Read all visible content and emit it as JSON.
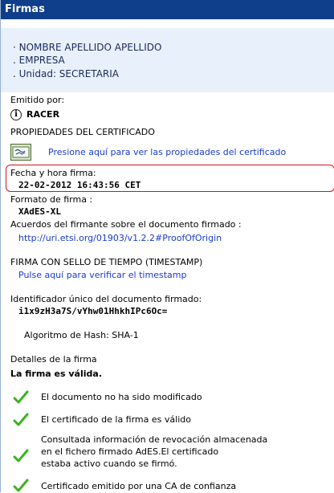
{
  "header": {
    "title": "Firmas"
  },
  "signer": {
    "name": "· NOMBRE APELLIDO APELLIDO",
    "company": ". EMPRESA",
    "unit": ". Unidad: SECRETARIA"
  },
  "issuer": {
    "label": "Emitido por:",
    "value": "RACER",
    "icon": "info-icon"
  },
  "certificate": {
    "section_title": "PROPIEDADES DEL CERTIFICADO",
    "link": "Presione aquí para ver las propiedades del certificado",
    "icon": "certificate-icon"
  },
  "signature_datetime": {
    "label": "Fecha y hora firma:",
    "value": "22-02-2012 16:43:56 CET",
    "highlight_color": "#d0141c"
  },
  "signature_format": {
    "label": "Formato de firma :",
    "value": "XAdES-XL"
  },
  "agreements": {
    "label": "Acuerdos del firmante sobre el documento firmado :",
    "link": "http://uri.etsi.org/01903/v1.2.2#ProofOfOrigin"
  },
  "timestamp": {
    "label": "FIRMA CON SELLO DE TIEMPO (TIMESTAMP)",
    "link": "Pulse aquí para verificar el timestamp"
  },
  "document_id": {
    "label": "Identificador único del documento firmado:",
    "value": "i1x9zH3a7S/vYhw01HhkhIPc6Oc="
  },
  "hash": {
    "label": "Algoritmo de Hash: SHA-1"
  },
  "details": {
    "label": "Detalles de la firma",
    "status": "La firma es válida."
  },
  "checks": [
    {
      "text": "El documento no ha sido modificado",
      "icon": "check-icon"
    },
    {
      "text": "El certificado de la firma es válido",
      "icon": "check-icon"
    },
    {
      "lines": [
        "Consultada información de revocación almacenada",
        "en el fichero firmado AdES.El certificado",
        "estaba activo cuando se firmó."
      ],
      "icon": "check-icon"
    },
    {
      "text": "Certificado emitido por una CA de confianza",
      "icon": "check-icon"
    }
  ],
  "colors": {
    "header_bg": "#0f3e8a",
    "signer_bg": "#e8f1fb",
    "link": "#1a3ccc",
    "check": "#3cb21f"
  }
}
